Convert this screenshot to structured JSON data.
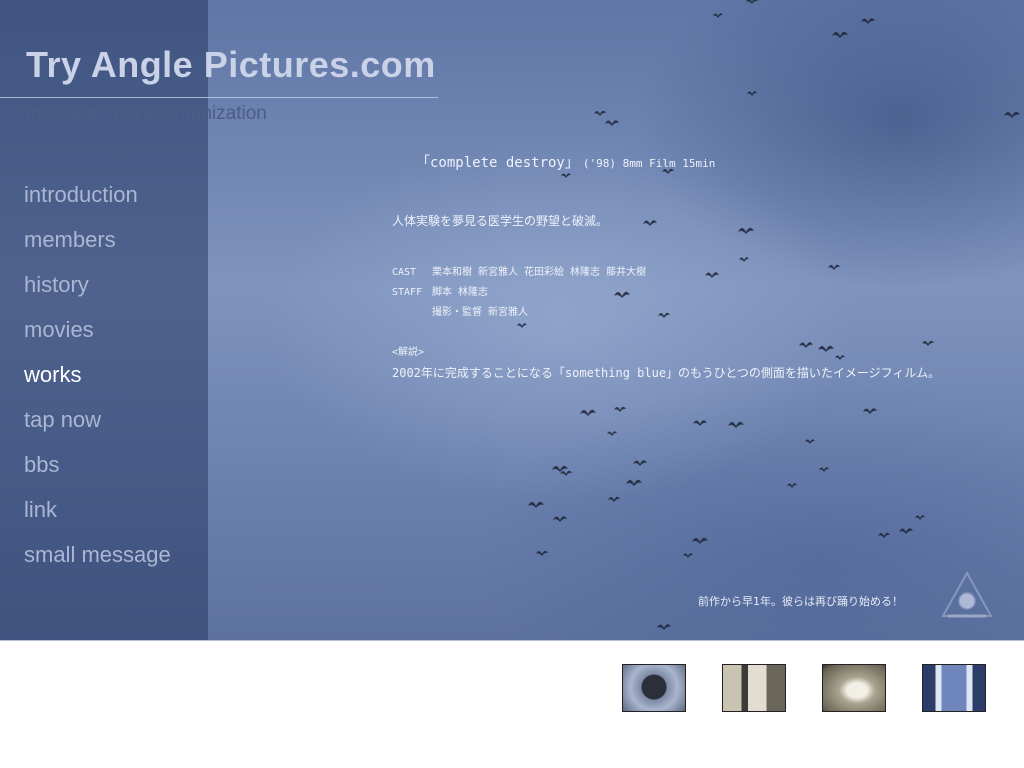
{
  "site": {
    "title": "Try Angle Pictures.com",
    "subtitle": "message movie organization"
  },
  "nav": {
    "items": [
      {
        "label": "introduction",
        "active": false
      },
      {
        "label": "members",
        "active": false
      },
      {
        "label": "history",
        "active": false
      },
      {
        "label": "movies",
        "active": false
      },
      {
        "label": "works",
        "active": true
      },
      {
        "label": "tap now",
        "active": false
      },
      {
        "label": "bbs",
        "active": false
      },
      {
        "label": "link",
        "active": false
      },
      {
        "label": "small message",
        "active": false
      }
    ]
  },
  "work": {
    "title": "「complete destroy」",
    "meta": "('98)  8mm Film  15min",
    "tagline": "人体実験を夢見る医学生の野望と破滅。",
    "cast_label": "CAST",
    "cast": "栗本和樹  新宮雅人  花田彩絵  林隆志  藤井大樹",
    "staff_label": "STAFF",
    "staff_1": "脚本  林隆志",
    "staff_2": "撮影・監督  新宮雅人",
    "desc_label": "<解説>",
    "desc": "2002年に完成することになる「something blue」のもうひとつの側面を描いたイメージフィルム。"
  },
  "footnote": "前作から早1年。彼らは再び踊り始める！",
  "icons": {
    "logo": "triangle-circle-logo-icon",
    "birds": "flying-bird-icon"
  },
  "colors": {
    "sidebar_text": "#aab6d2",
    "active_text": "#ffffff",
    "sky": "#7e93bd"
  },
  "thumbnails": [
    {
      "name": "thumbnail-1"
    },
    {
      "name": "thumbnail-2"
    },
    {
      "name": "thumbnail-3"
    },
    {
      "name": "thumbnail-4"
    }
  ]
}
